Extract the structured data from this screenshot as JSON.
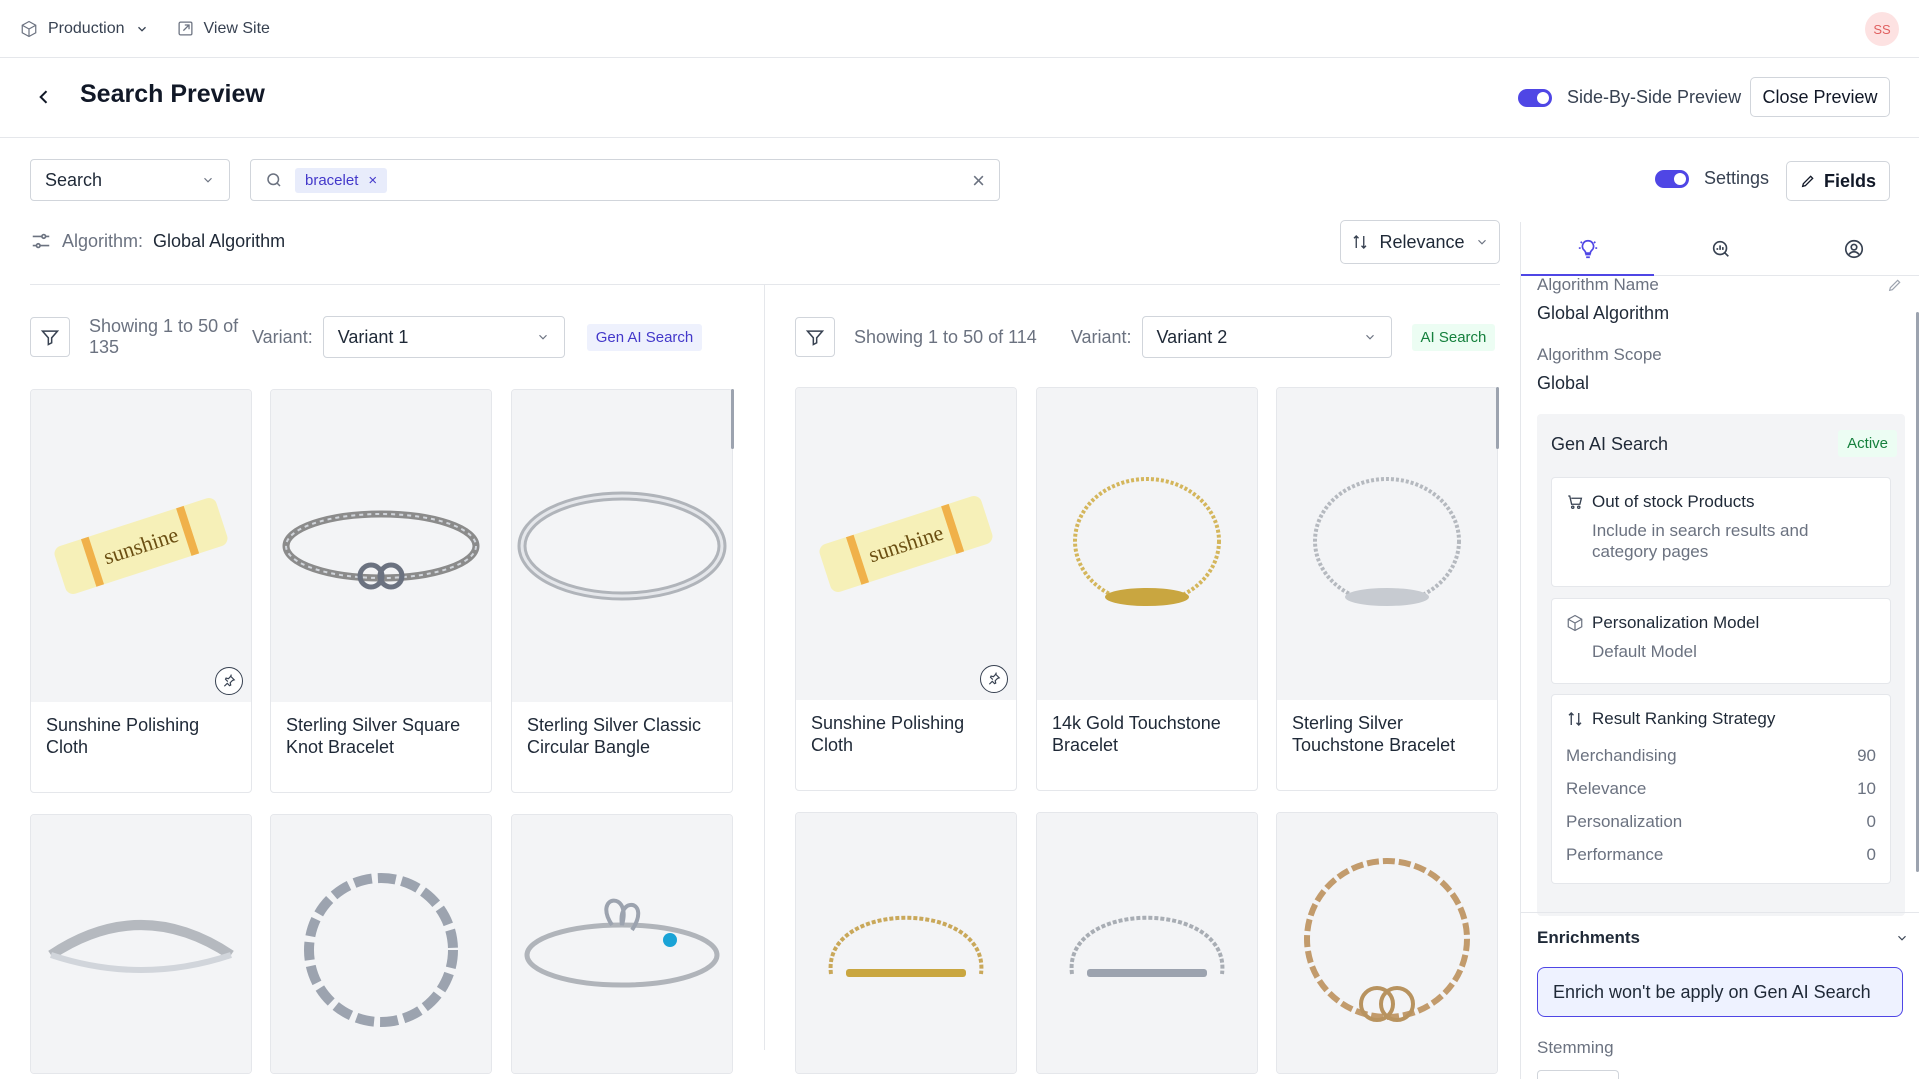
{
  "topbar": {
    "env": "Production",
    "view_site": "View Site",
    "avatar": "SS"
  },
  "header": {
    "title": "Search Preview",
    "side_by_side_label": "Side-By-Side Preview",
    "close_label": "Close Preview"
  },
  "search": {
    "mode": "Search",
    "chip": "bracelet",
    "settings_label": "Settings",
    "fields_label": "Fields"
  },
  "algorithm": {
    "label": "Algorithm:",
    "value": "Global Algorithm"
  },
  "sort": {
    "label": "Relevance"
  },
  "left_panel": {
    "showing": "Showing 1 to 50 of 135",
    "variant_label": "Variant:",
    "variant_value": "Variant 1",
    "badge": "Gen AI Search",
    "products": [
      {
        "name": "Sunshine Polishing Cloth"
      },
      {
        "name": "Sterling Silver Square Knot Bracelet"
      },
      {
        "name": "Sterling Silver Classic Circular Bangle"
      },
      {
        "name": ""
      },
      {
        "name": ""
      },
      {
        "name": ""
      }
    ]
  },
  "right_panel": {
    "showing": "Showing 1 to 50 of 114",
    "variant_label": "Variant:",
    "variant_value": "Variant 2",
    "badge": "AI Search",
    "products": [
      {
        "name": "Sunshine Polishing Cloth"
      },
      {
        "name": "14k Gold Touchstone Bracelet"
      },
      {
        "name": "Sterling Silver Touchstone Bracelet"
      },
      {
        "name": ""
      },
      {
        "name": ""
      },
      {
        "name": ""
      }
    ]
  },
  "sidebar": {
    "algorithm_name_label": "Algorithm Name",
    "algorithm_name": "Global Algorithm",
    "algorithm_scope_label": "Algorithm Scope",
    "algorithm_scope": "Global",
    "gen_ai": {
      "title": "Gen AI Search",
      "status": "Active"
    },
    "out_of_stock": {
      "title": "Out of stock Products",
      "desc": "Include in search results and category pages"
    },
    "personalization": {
      "title": "Personalization Model",
      "desc": "Default Model"
    },
    "ranking": {
      "title": "Result Ranking Strategy",
      "rows": [
        {
          "label": "Merchandising",
          "value": "90"
        },
        {
          "label": "Relevance",
          "value": "10"
        },
        {
          "label": "Personalization",
          "value": "0"
        },
        {
          "label": "Performance",
          "value": "0"
        }
      ]
    },
    "enrichments": {
      "title": "Enrichments",
      "note": "Enrich won't be apply on Gen AI Search"
    },
    "stemming_label": "Stemming"
  },
  "colors": {
    "accent": "#4f46e5",
    "active_green": "#15803d"
  }
}
